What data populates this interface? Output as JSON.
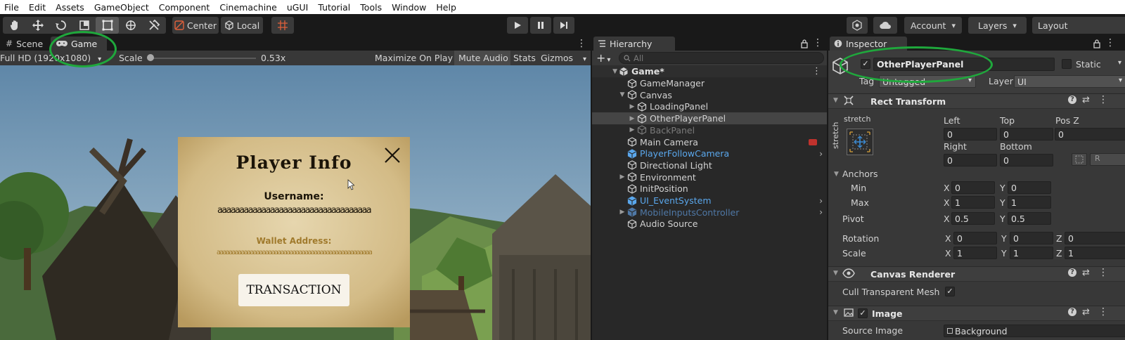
{
  "menu": [
    "File",
    "Edit",
    "Assets",
    "GameObject",
    "Component",
    "Cinemachine",
    "uGUI",
    "Tutorial",
    "Tools",
    "Window",
    "Help"
  ],
  "toolbar": {
    "pivot_label": "Center",
    "space_label": "Local",
    "account_label": "Account",
    "layers_label": "Layers",
    "layout_label": "Layout"
  },
  "game_panel": {
    "tab_scene": "Scene",
    "tab_game": "Game",
    "resolution": "Full HD (1920x1080)",
    "scale_label": "Scale",
    "scale_value": "0.53x",
    "scale_fraction": 0.0,
    "maximize_label": "Maximize On Play",
    "mute_label": "Mute Audio",
    "stats_label": "Stats",
    "gizmos_label": "Gizmos"
  },
  "popup": {
    "title": "Player Info",
    "username_label": "Username:",
    "username_value": "aaaaaaaaaaaaaaaaaaaaaaaaaaaaaaaaaaa",
    "wallet_label": "Wallet Address:",
    "wallet_value": "aaaaaaaaaaaaaaaaaaaaaaaaaaaaaaaaaaaaaaaaaaaaaaaaaaa",
    "button_label": "TRANSACTION"
  },
  "hierarchy": {
    "title": "Hierarchy",
    "search_placeholder": "All",
    "scene_name": "Game*",
    "items": [
      {
        "label": "GameManager",
        "style": "normal"
      },
      {
        "label": "Canvas",
        "style": "normal"
      },
      {
        "label": "LoadingPanel",
        "style": "normal"
      },
      {
        "label": "OtherPlayerPanel",
        "style": "normal"
      },
      {
        "label": "BackPanel",
        "style": "dim"
      },
      {
        "label": "Main Camera",
        "style": "normal"
      },
      {
        "label": "PlayerFollowCamera",
        "style": "prefab"
      },
      {
        "label": "Directional Light",
        "style": "normal"
      },
      {
        "label": "Environment",
        "style": "normal"
      },
      {
        "label": "InitPosition",
        "style": "normal"
      },
      {
        "label": "UI_EventSystem",
        "style": "prefab"
      },
      {
        "label": "MobileInputsController",
        "style": "prefab-dim"
      },
      {
        "label": "Audio Source",
        "style": "normal"
      }
    ]
  },
  "inspector": {
    "title": "Inspector",
    "object_name": "OtherPlayerPanel",
    "static_label": "Static",
    "tag_label": "Tag",
    "tag_value": "Untagged",
    "layer_label": "Layer",
    "layer_value": "UI",
    "rect_transform": {
      "header": "Rect Transform",
      "stretch_label": "stretch",
      "stretch_side": "stretch",
      "left_label": "Left",
      "left_value": "0",
      "top_label": "Top",
      "top_value": "0",
      "posz_label": "Pos Z",
      "posz_value": "0",
      "right_label": "Right",
      "right_value": "0",
      "bottom_label": "Bottom",
      "bottom_value": "0",
      "r_button": "R",
      "anchors_label": "Anchors",
      "min_label": "Min",
      "min_x": "0",
      "min_y": "0",
      "max_label": "Max",
      "max_x": "1",
      "max_y": "1",
      "pivot_label": "Pivot",
      "pivot_x": "0.5",
      "pivot_y": "0.5",
      "rotation_label": "Rotation",
      "rot_x": "0",
      "rot_y": "0",
      "rot_z": "0",
      "scale_label": "Scale",
      "scale_x": "1",
      "scale_y": "1",
      "scale_z": "1",
      "x": "X",
      "y": "Y",
      "z": "Z"
    },
    "canvas_renderer": {
      "header": "Canvas Renderer",
      "cull_label": "Cull Transparent Mesh"
    },
    "image": {
      "header": "Image",
      "source_label": "Source Image",
      "source_value": "Background"
    }
  }
}
